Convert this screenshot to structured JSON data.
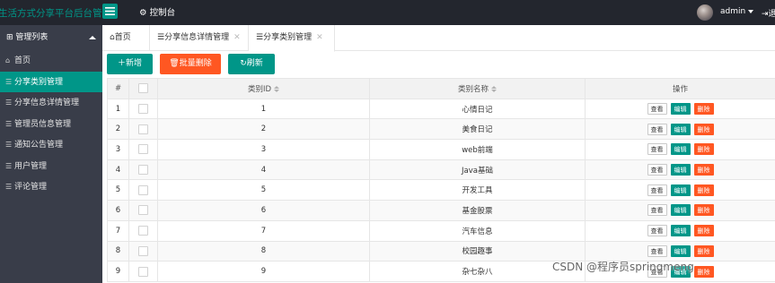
{
  "header": {
    "brand": "生活方式分享平台后台管理",
    "console_label": "控制台",
    "console_icon": "gear-icon",
    "user": "admin",
    "logout": "退"
  },
  "sidebar": {
    "title": "管理列表",
    "items": [
      {
        "label": "首页",
        "icon": "home-icon",
        "active": false
      },
      {
        "label": "分享类别管理",
        "icon": "list-icon",
        "active": true
      },
      {
        "label": "分享信息详情管理",
        "icon": "list-icon",
        "active": false
      },
      {
        "label": "管理员信息管理",
        "icon": "list-icon",
        "active": false
      },
      {
        "label": "通知公告管理",
        "icon": "list-icon",
        "active": false
      },
      {
        "label": "用户管理",
        "icon": "list-icon",
        "active": false
      },
      {
        "label": "评论管理",
        "icon": "list-icon",
        "active": false
      }
    ]
  },
  "tabs": [
    {
      "label": "首页",
      "icon": "home-icon",
      "closable": false,
      "active": false
    },
    {
      "label": "分享信息详情管理",
      "icon": "list-icon",
      "closable": true,
      "active": false
    },
    {
      "label": "分享类别管理",
      "icon": "list-icon",
      "closable": true,
      "active": true
    }
  ],
  "toolbar": {
    "add": "新增",
    "batch_delete": "批量删除",
    "refresh": "刷新"
  },
  "table": {
    "columns": [
      "#",
      "",
      "类别ID",
      "类别名称",
      "操作"
    ],
    "actions": {
      "view": "查看",
      "edit": "编辑",
      "delete": "删除"
    },
    "rows": [
      {
        "index": "1",
        "id": "1",
        "name": "心情日记"
      },
      {
        "index": "2",
        "id": "2",
        "name": "美食日记"
      },
      {
        "index": "3",
        "id": "3",
        "name": "web前端"
      },
      {
        "index": "4",
        "id": "4",
        "name": "Java基础"
      },
      {
        "index": "5",
        "id": "5",
        "name": "开发工具"
      },
      {
        "index": "6",
        "id": "6",
        "name": "基金股票"
      },
      {
        "index": "7",
        "id": "7",
        "name": "汽车信息"
      },
      {
        "index": "8",
        "id": "8",
        "name": "校园趣事"
      },
      {
        "index": "9",
        "id": "9",
        "name": "杂七杂八"
      }
    ]
  },
  "watermark": "CSDN @程序员springmeng",
  "colors": {
    "topbar": "#23262e",
    "sidebar": "#393d49",
    "accent": "#009688",
    "danger": "#ff5722"
  }
}
